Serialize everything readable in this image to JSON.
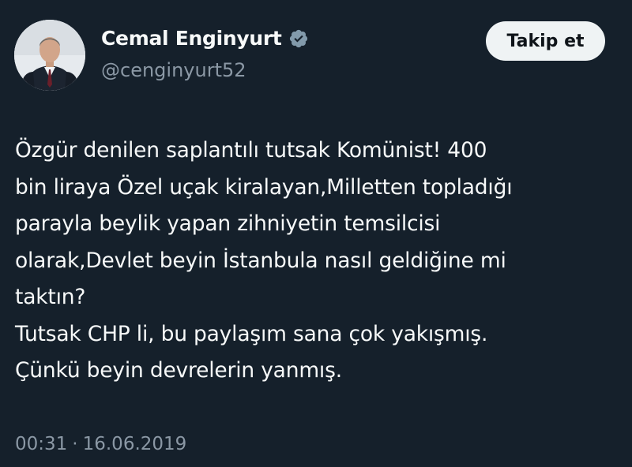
{
  "author": {
    "display_name": "Cemal Enginyurt",
    "handle": "@cenginyurt52",
    "verified": true,
    "avatar_icon": "profile-photo"
  },
  "actions": {
    "follow_label": "Takip et"
  },
  "tweet": {
    "lines": [
      "Özgür denilen saplantılı tutsak Komünist! 400",
      "bin liraya Özel uçak kiralayan,Milletten topladığı",
      "parayla beylik yapan zihniyetin temsilcisi",
      "olarak,Devlet beyin İstanbula nasıl geldiğine mi",
      "taktın?",
      "Tutsak CHP li, bu paylaşım sana çok yakışmış.",
      "Çünkü beyin devrelerin yanmış."
    ],
    "time": "00:31",
    "separator": "·",
    "date": "16.06.2019"
  },
  "colors": {
    "background": "#15202b",
    "text_primary": "#f7f9f9",
    "text_secondary": "#8b98a5",
    "verified_badge": "#829aab",
    "button_bg": "#eff3f4",
    "button_text": "#0f1419"
  }
}
